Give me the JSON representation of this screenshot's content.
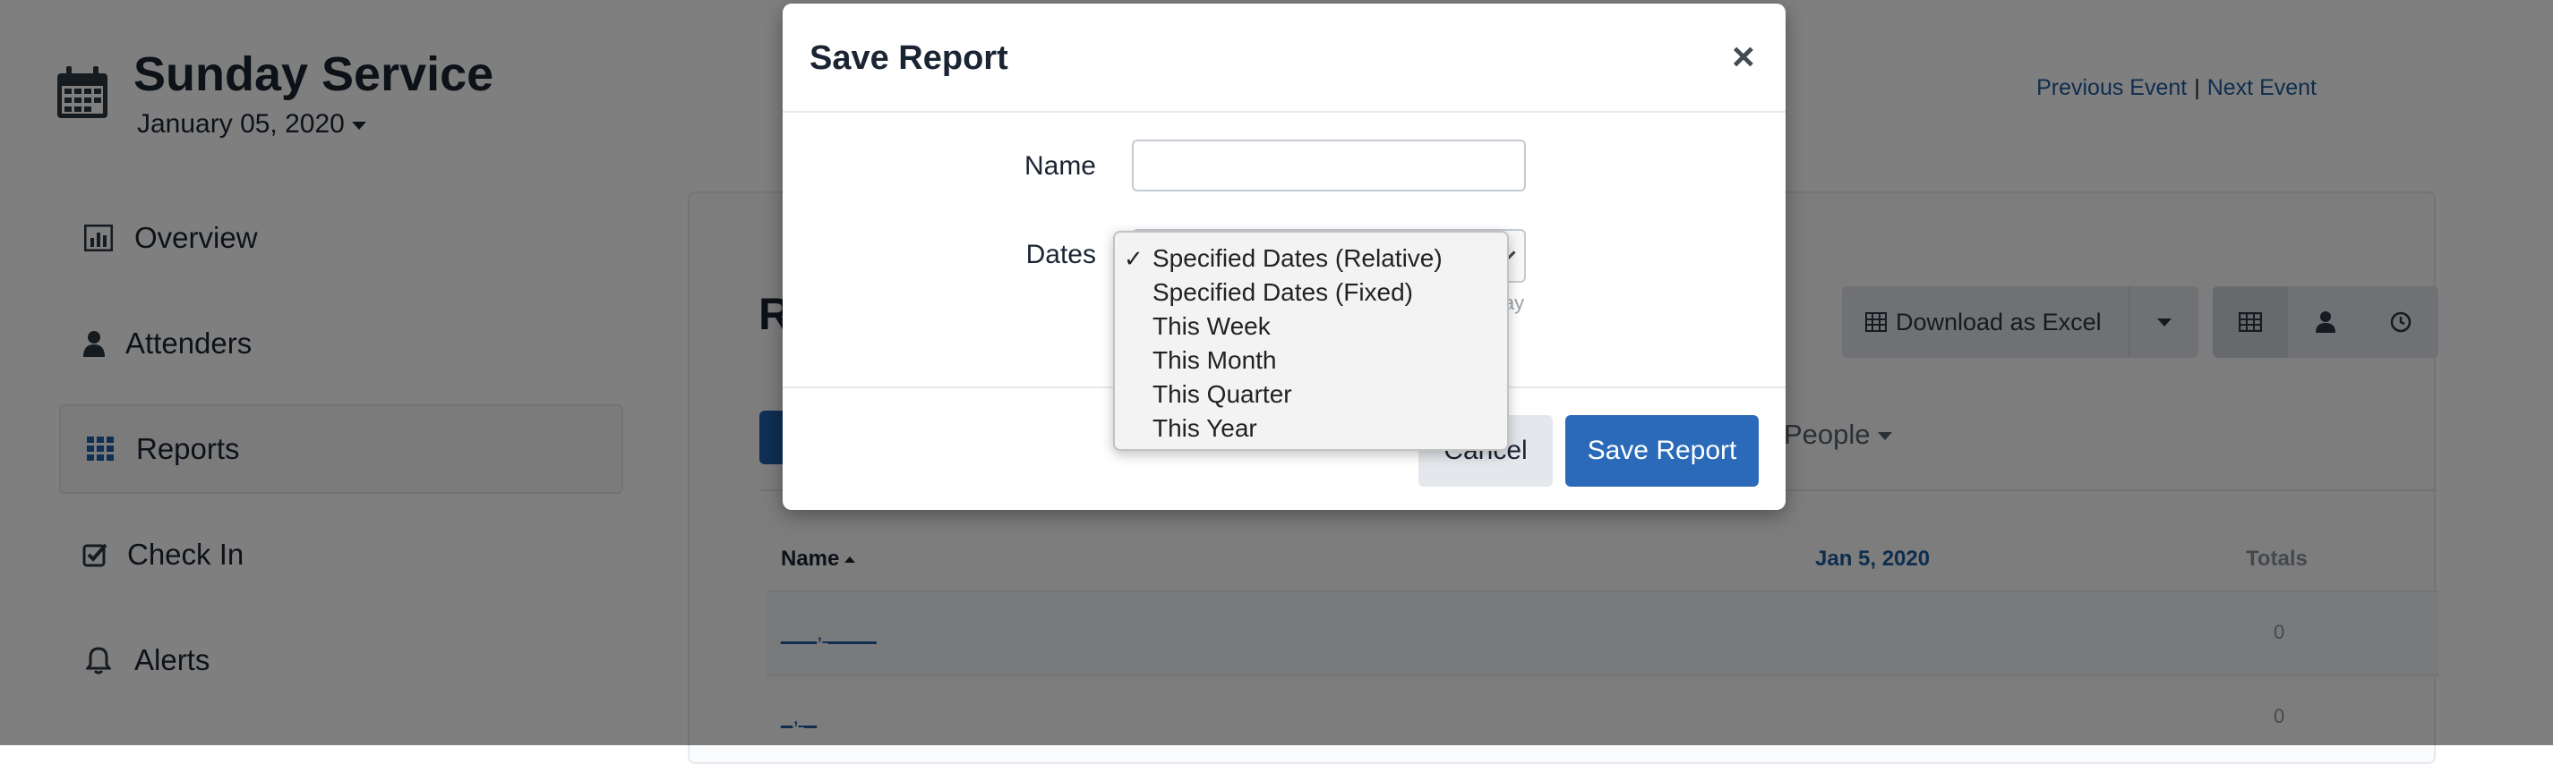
{
  "event": {
    "title": "Sunday Service",
    "date": "January 05, 2020",
    "icon": "calendar-icon"
  },
  "top_nav": {
    "previous": "Previous Event",
    "separator": "|",
    "next": "Next Event"
  },
  "sidebar": {
    "items": [
      {
        "label": "Overview",
        "icon": "bar-chart-icon",
        "active": false
      },
      {
        "label": "Attenders",
        "icon": "user-icon",
        "active": false
      },
      {
        "label": "Reports",
        "icon": "grid-icon",
        "active": true
      },
      {
        "label": "Check In",
        "icon": "checkbox-icon",
        "active": false
      },
      {
        "label": "Alerts",
        "icon": "bell-icon",
        "active": false
      }
    ]
  },
  "reports": {
    "title_fragment": "R",
    "people_tab": "People",
    "download": {
      "label": "Download as Excel",
      "icon": "table-icon"
    },
    "views": [
      "table-view-icon",
      "person-view-icon",
      "clock-view-icon"
    ],
    "table": {
      "columns": [
        "Name",
        "Jan 5, 2020",
        "Totals"
      ],
      "rows": [
        {
          "name": "___, ____",
          "total": "0"
        },
        {
          "name": "_, _",
          "total": "0"
        }
      ]
    }
  },
  "modal": {
    "title": "Save Report",
    "close": "×",
    "name_label": "Name",
    "name_value": "",
    "dates_label": "Dates",
    "help_fragment": "lay",
    "cancel_label": "Cancel",
    "save_label": "Save Report"
  },
  "dates_dropdown": {
    "selected_mark": "✓",
    "options": [
      {
        "label": "Specified Dates (Relative)",
        "selected": true
      },
      {
        "label": "Specified Dates (Fixed)",
        "selected": false
      },
      {
        "label": "This Week",
        "selected": false
      },
      {
        "label": "This Month",
        "selected": false
      },
      {
        "label": "This Quarter",
        "selected": false
      },
      {
        "label": "This Year",
        "selected": false
      }
    ]
  },
  "colors": {
    "primary": "#2a6ab8",
    "link": "#1e5a9c",
    "backdrop": "rgba(0,0,0,0.5)"
  }
}
